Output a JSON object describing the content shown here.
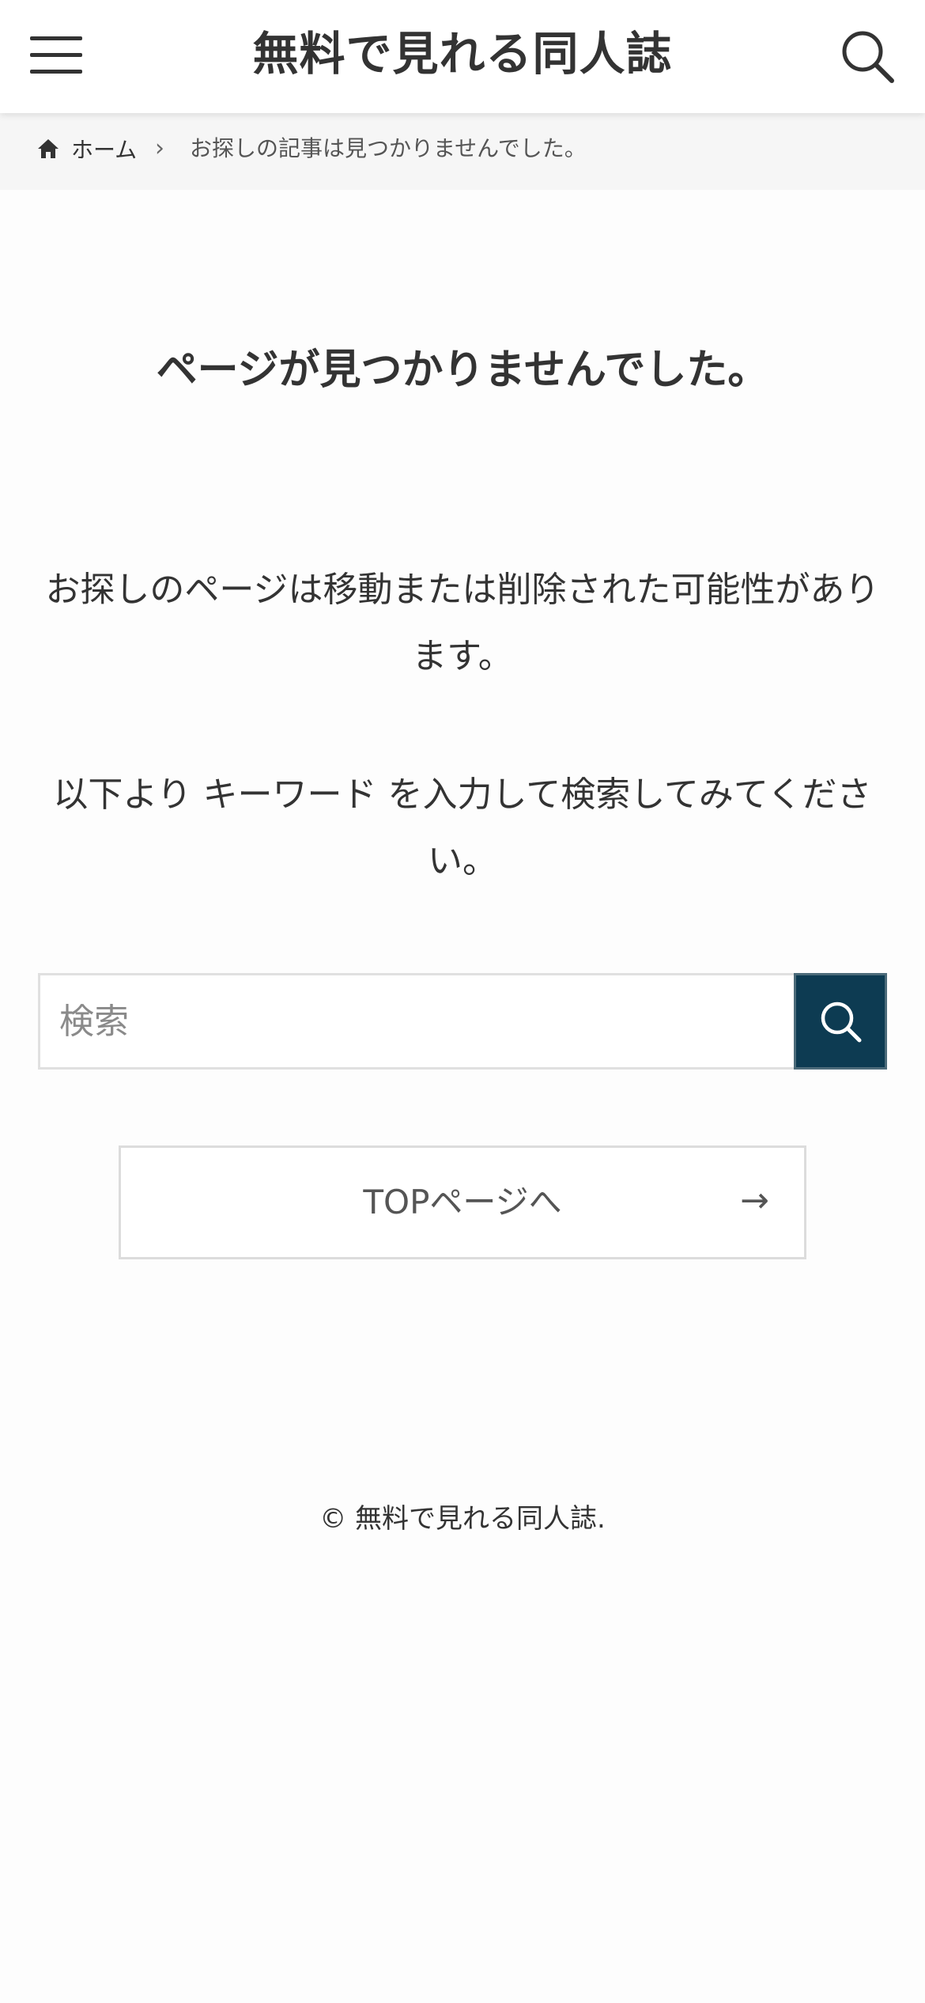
{
  "header": {
    "site_title": "無料で見れる同人誌",
    "menu_icon": "hamburger-menu-icon",
    "search_icon": "search-icon"
  },
  "breadcrumb": {
    "home_label": "ホーム",
    "separator": "›",
    "current": "お探しの記事は見つかりませんでした。"
  },
  "main": {
    "title": "ページが見つかりませんでした。",
    "message_1": "お探しのページは移動または削除された可能性があります。",
    "message_2": "以下より キーワード を入力して検索してみてください。",
    "search": {
      "placeholder": "検索",
      "value": ""
    },
    "top_button": {
      "label": "TOPページへ",
      "arrow": "→"
    }
  },
  "footer": {
    "copyright": "© 無料で見れる同人誌."
  },
  "colors": {
    "accent": "#0d3b52",
    "text": "#333333",
    "breadcrumb_bg": "#f6f6f6"
  }
}
